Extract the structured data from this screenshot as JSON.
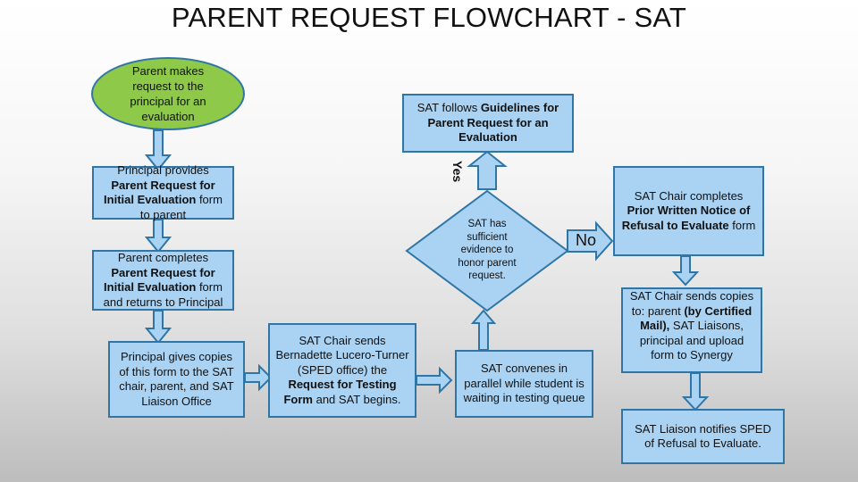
{
  "title": "PARENT REQUEST FLOWCHART - SAT",
  "colors": {
    "box_fill": "#aad3f3",
    "box_border": "#2f76a7",
    "start_fill": "#8ec94a"
  },
  "nodes": {
    "start": {
      "text": "Parent makes request to the principal for an evaluation"
    },
    "principal_provides": {
      "pre": "Principal provides ",
      "bold": "Parent Request for Initial Evaluation",
      "post": " form to parent"
    },
    "parent_completes": {
      "pre": "Parent completes ",
      "bold": "Parent Request for Initial Evaluation",
      "post": " form and returns  to Principal"
    },
    "principal_gives": {
      "text": "Principal gives copies of this form to the SAT chair, parent, and SAT Liaison Office"
    },
    "sat_chair_sends": {
      "pre": "SAT Chair sends Bernadette Lucero-Turner (SPED office) the ",
      "bold": "Request for Testing Form",
      "post": " and SAT begins."
    },
    "sat_convenes": {
      "text": "SAT convenes in parallel while student is waiting in testing queue"
    },
    "decision": {
      "text": "SAT has sufficient evidence to honor parent request."
    },
    "sat_follows": {
      "pre": "SAT follows ",
      "bold": "Guidelines for Parent Request for an Evaluation",
      "post": ""
    },
    "pwn_refusal": {
      "pre": "SAT Chair completes ",
      "bold": "Prior Written Notice of Refusal to Evaluate",
      "post": " form"
    },
    "sends_copies": {
      "pre": "SAT Chair sends copies to: parent ",
      "bold": "(by Certified Mail),",
      "post": " SAT Liaisons, principal and upload form to Synergy"
    },
    "liaison_notifies": {
      "text": "SAT Liaison notifies SPED of Refusal to Evaluate."
    }
  },
  "edge_labels": {
    "yes": "Yes",
    "no": "No"
  }
}
